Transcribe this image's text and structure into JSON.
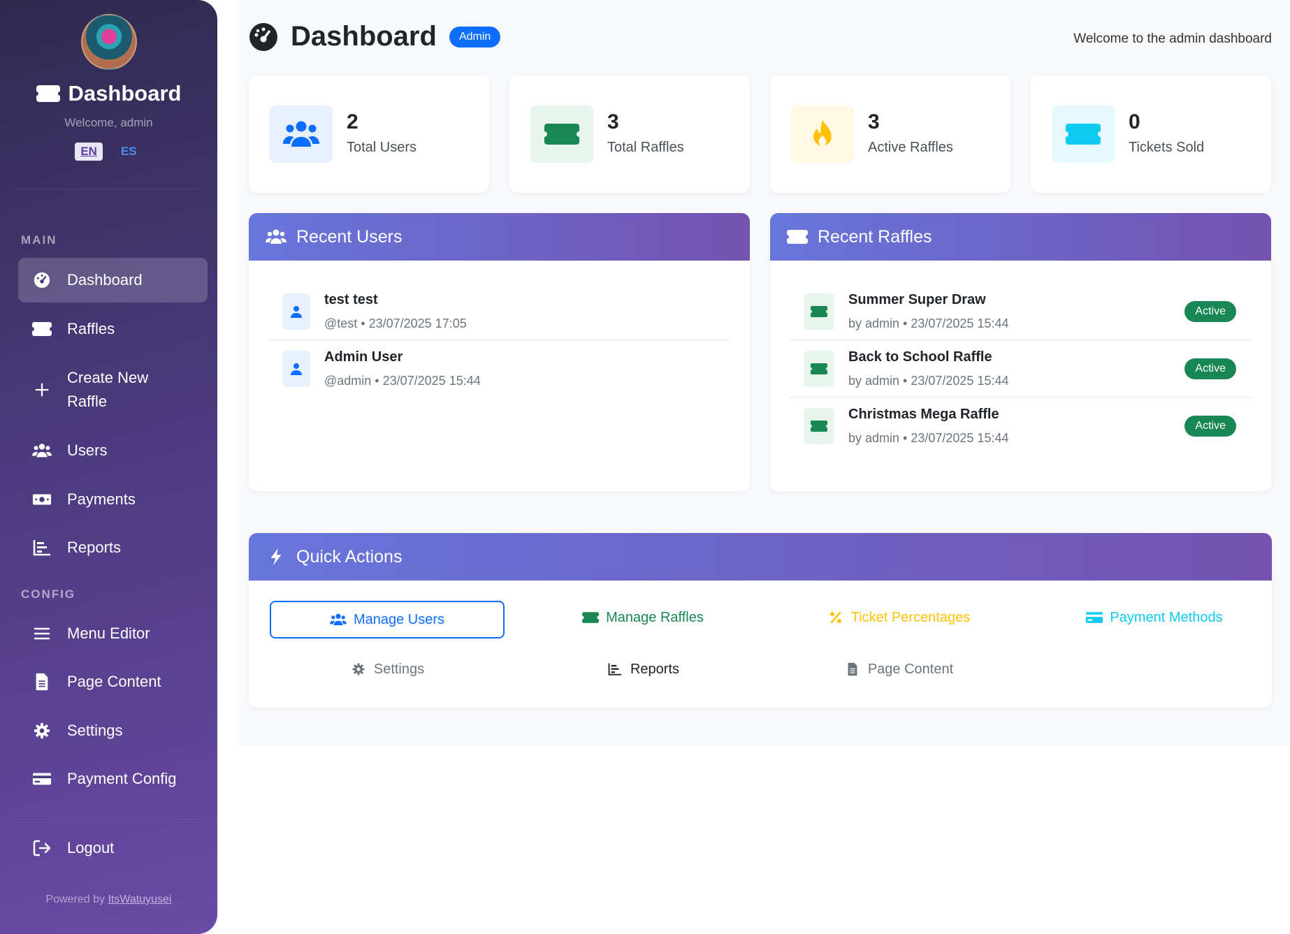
{
  "sidebar": {
    "title": "Dashboard",
    "welcome": "Welcome, admin",
    "languages": [
      "EN",
      "ES"
    ],
    "sections": {
      "main": "MAIN",
      "config": "CONFIG"
    },
    "items": {
      "dashboard": "Dashboard",
      "raffles": "Raffles",
      "create_line1": "Create New",
      "create_line2": "Raffle",
      "users": "Users",
      "payments": "Payments",
      "reports": "Reports",
      "menu_editor": "Menu Editor",
      "page_content": "Page Content",
      "settings": "Settings",
      "payment_config": "Payment Config",
      "logout": "Logout"
    },
    "footer_prefix": "Powered by",
    "footer_link": "ItsWatuyusei"
  },
  "header": {
    "title": "Dashboard",
    "badge": "Admin",
    "welcome": "Welcome to the admin dashboard"
  },
  "stats": [
    {
      "value": "2",
      "label": "Total Users",
      "color": "#0d6efd",
      "bg": "#e7f0ff"
    },
    {
      "value": "3",
      "label": "Total Raffles",
      "color": "#198754",
      "bg": "#e8f4ee"
    },
    {
      "value": "3",
      "label": "Active Raffles",
      "color": "#ffc107",
      "bg": "#fff8e3"
    },
    {
      "value": "0",
      "label": "Tickets Sold",
      "color": "#0dcaf0",
      "bg": "#e5f9fd"
    }
  ],
  "recent_users": {
    "title": "Recent Users",
    "items": [
      {
        "name": "test test",
        "meta": "@test • 23/07/2025 17:05"
      },
      {
        "name": "Admin User",
        "meta": "@admin • 23/07/2025 15:44"
      }
    ]
  },
  "recent_raffles": {
    "title": "Recent Raffles",
    "items": [
      {
        "name": "Summer Super Draw",
        "meta": "by admin • 23/07/2025 15:44",
        "status": "Active"
      },
      {
        "name": "Back to School Raffle",
        "meta": "by admin • 23/07/2025 15:44",
        "status": "Active"
      },
      {
        "name": "Christmas Mega Raffle",
        "meta": "by admin • 23/07/2025 15:44",
        "status": "Active"
      }
    ]
  },
  "quick_actions": {
    "title": "Quick Actions",
    "buttons": {
      "manage_users": "Manage Users",
      "manage_raffles": "Manage Raffles",
      "ticket_percentages": "Ticket Percentages",
      "payment_methods": "Payment Methods",
      "settings": "Settings",
      "reports": "Reports",
      "page_content": "Page Content"
    }
  },
  "colors": {
    "primary": "#0d6efd",
    "success": "#198754",
    "warning": "#ffc107",
    "info": "#0dcaf0",
    "secondary": "#6c757d",
    "dark": "#212529",
    "header_gradient_start": "#6776db",
    "header_gradient_end": "#7352b0"
  }
}
